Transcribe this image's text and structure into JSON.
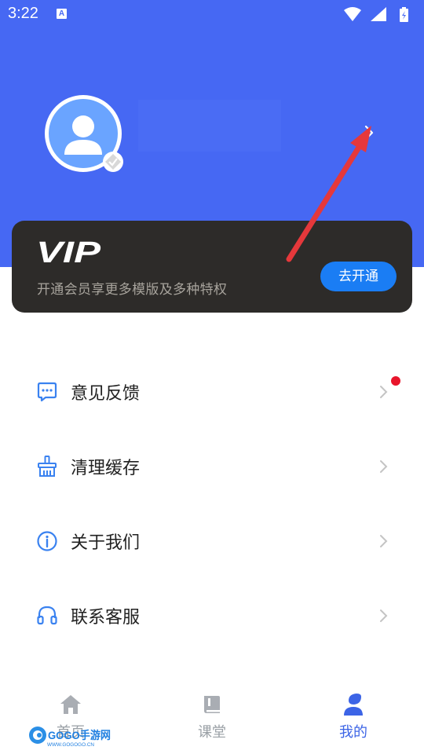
{
  "status_bar": {
    "time": "3:22",
    "notification_icon": "A"
  },
  "profile": {
    "name": "",
    "avatar_icon": "person-icon",
    "chevron_icon": "chevron-right-icon"
  },
  "vip": {
    "logo": "VIP",
    "description": "开通会员享更多模版及多种特权",
    "button_label": "去开通",
    "button_color": "#1a7df4"
  },
  "menu": [
    {
      "label": "意见反馈",
      "icon": "feedback-message-icon",
      "has_badge": true
    },
    {
      "label": "清理缓存",
      "icon": "broom-icon",
      "has_badge": false
    },
    {
      "label": "关于我们",
      "icon": "info-icon",
      "has_badge": false
    },
    {
      "label": "联系客服",
      "icon": "headset-icon",
      "has_badge": false
    }
  ],
  "tabs": [
    {
      "label": "首页",
      "icon": "home-icon",
      "active": false
    },
    {
      "label": "课堂",
      "icon": "book-icon",
      "active": false
    },
    {
      "label": "我的",
      "icon": "user-icon",
      "active": true
    }
  ],
  "watermark": {
    "brand": "GOGO手游网",
    "url": "WWW.GOGOGO.CN"
  },
  "colors": {
    "header": "#4668f3",
    "accent": "#3c64e6",
    "vip_card": "#2d2b29",
    "badge": "#e8152b",
    "annotation_arrow": "#e5383b"
  }
}
